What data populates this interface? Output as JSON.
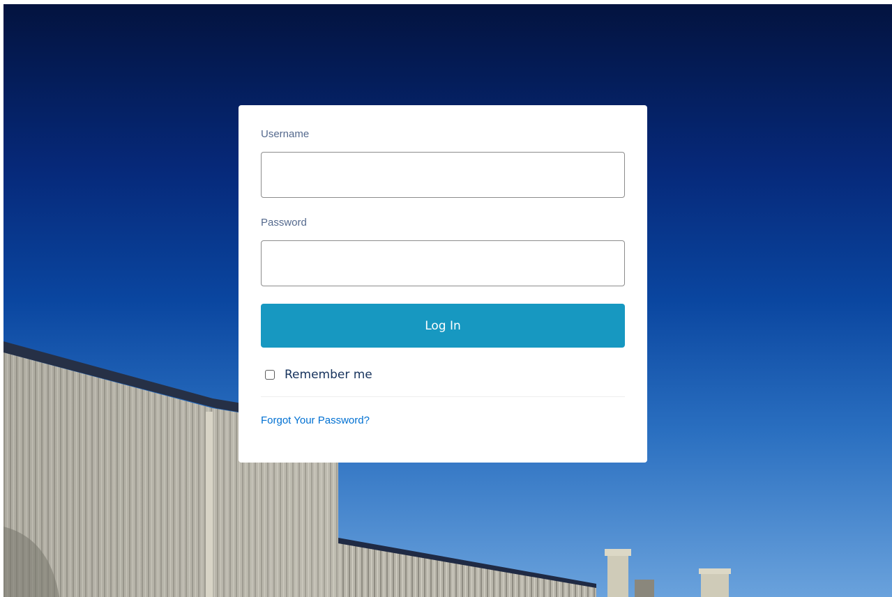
{
  "login_form": {
    "username_label": "Username",
    "username_value": "",
    "password_label": "Password",
    "password_value": "",
    "login_button_label": "Log In",
    "remember_me_label": "Remember me",
    "remember_me_checked": false,
    "forgot_password_link": "Forgot Your Password?"
  },
  "colors": {
    "button": "#1798c1",
    "link": "#0070d2",
    "sky_top": "#03133f",
    "sky_bottom": "#6aa2dc"
  }
}
